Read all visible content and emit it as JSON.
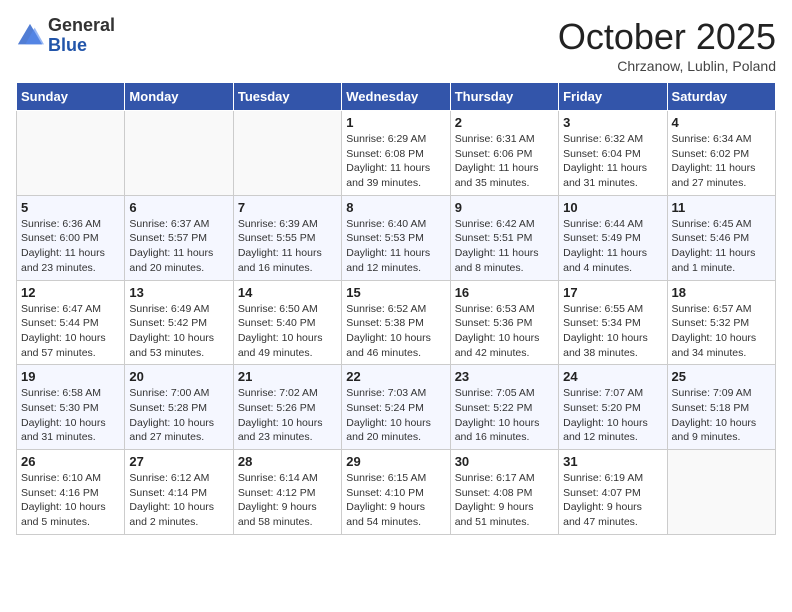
{
  "header": {
    "logo_general": "General",
    "logo_blue": "Blue",
    "month": "October 2025",
    "location": "Chrzanow, Lublin, Poland"
  },
  "weekdays": [
    "Sunday",
    "Monday",
    "Tuesday",
    "Wednesday",
    "Thursday",
    "Friday",
    "Saturday"
  ],
  "weeks": [
    [
      {
        "day": "",
        "info": ""
      },
      {
        "day": "",
        "info": ""
      },
      {
        "day": "",
        "info": ""
      },
      {
        "day": "1",
        "info": "Sunrise: 6:29 AM\nSunset: 6:08 PM\nDaylight: 11 hours\nand 39 minutes."
      },
      {
        "day": "2",
        "info": "Sunrise: 6:31 AM\nSunset: 6:06 PM\nDaylight: 11 hours\nand 35 minutes."
      },
      {
        "day": "3",
        "info": "Sunrise: 6:32 AM\nSunset: 6:04 PM\nDaylight: 11 hours\nand 31 minutes."
      },
      {
        "day": "4",
        "info": "Sunrise: 6:34 AM\nSunset: 6:02 PM\nDaylight: 11 hours\nand 27 minutes."
      }
    ],
    [
      {
        "day": "5",
        "info": "Sunrise: 6:36 AM\nSunset: 6:00 PM\nDaylight: 11 hours\nand 23 minutes."
      },
      {
        "day": "6",
        "info": "Sunrise: 6:37 AM\nSunset: 5:57 PM\nDaylight: 11 hours\nand 20 minutes."
      },
      {
        "day": "7",
        "info": "Sunrise: 6:39 AM\nSunset: 5:55 PM\nDaylight: 11 hours\nand 16 minutes."
      },
      {
        "day": "8",
        "info": "Sunrise: 6:40 AM\nSunset: 5:53 PM\nDaylight: 11 hours\nand 12 minutes."
      },
      {
        "day": "9",
        "info": "Sunrise: 6:42 AM\nSunset: 5:51 PM\nDaylight: 11 hours\nand 8 minutes."
      },
      {
        "day": "10",
        "info": "Sunrise: 6:44 AM\nSunset: 5:49 PM\nDaylight: 11 hours\nand 4 minutes."
      },
      {
        "day": "11",
        "info": "Sunrise: 6:45 AM\nSunset: 5:46 PM\nDaylight: 11 hours\nand 1 minute."
      }
    ],
    [
      {
        "day": "12",
        "info": "Sunrise: 6:47 AM\nSunset: 5:44 PM\nDaylight: 10 hours\nand 57 minutes."
      },
      {
        "day": "13",
        "info": "Sunrise: 6:49 AM\nSunset: 5:42 PM\nDaylight: 10 hours\nand 53 minutes."
      },
      {
        "day": "14",
        "info": "Sunrise: 6:50 AM\nSunset: 5:40 PM\nDaylight: 10 hours\nand 49 minutes."
      },
      {
        "day": "15",
        "info": "Sunrise: 6:52 AM\nSunset: 5:38 PM\nDaylight: 10 hours\nand 46 minutes."
      },
      {
        "day": "16",
        "info": "Sunrise: 6:53 AM\nSunset: 5:36 PM\nDaylight: 10 hours\nand 42 minutes."
      },
      {
        "day": "17",
        "info": "Sunrise: 6:55 AM\nSunset: 5:34 PM\nDaylight: 10 hours\nand 38 minutes."
      },
      {
        "day": "18",
        "info": "Sunrise: 6:57 AM\nSunset: 5:32 PM\nDaylight: 10 hours\nand 34 minutes."
      }
    ],
    [
      {
        "day": "19",
        "info": "Sunrise: 6:58 AM\nSunset: 5:30 PM\nDaylight: 10 hours\nand 31 minutes."
      },
      {
        "day": "20",
        "info": "Sunrise: 7:00 AM\nSunset: 5:28 PM\nDaylight: 10 hours\nand 27 minutes."
      },
      {
        "day": "21",
        "info": "Sunrise: 7:02 AM\nSunset: 5:26 PM\nDaylight: 10 hours\nand 23 minutes."
      },
      {
        "day": "22",
        "info": "Sunrise: 7:03 AM\nSunset: 5:24 PM\nDaylight: 10 hours\nand 20 minutes."
      },
      {
        "day": "23",
        "info": "Sunrise: 7:05 AM\nSunset: 5:22 PM\nDaylight: 10 hours\nand 16 minutes."
      },
      {
        "day": "24",
        "info": "Sunrise: 7:07 AM\nSunset: 5:20 PM\nDaylight: 10 hours\nand 12 minutes."
      },
      {
        "day": "25",
        "info": "Sunrise: 7:09 AM\nSunset: 5:18 PM\nDaylight: 10 hours\nand 9 minutes."
      }
    ],
    [
      {
        "day": "26",
        "info": "Sunrise: 6:10 AM\nSunset: 4:16 PM\nDaylight: 10 hours\nand 5 minutes."
      },
      {
        "day": "27",
        "info": "Sunrise: 6:12 AM\nSunset: 4:14 PM\nDaylight: 10 hours\nand 2 minutes."
      },
      {
        "day": "28",
        "info": "Sunrise: 6:14 AM\nSunset: 4:12 PM\nDaylight: 9 hours\nand 58 minutes."
      },
      {
        "day": "29",
        "info": "Sunrise: 6:15 AM\nSunset: 4:10 PM\nDaylight: 9 hours\nand 54 minutes."
      },
      {
        "day": "30",
        "info": "Sunrise: 6:17 AM\nSunset: 4:08 PM\nDaylight: 9 hours\nand 51 minutes."
      },
      {
        "day": "31",
        "info": "Sunrise: 6:19 AM\nSunset: 4:07 PM\nDaylight: 9 hours\nand 47 minutes."
      },
      {
        "day": "",
        "info": ""
      }
    ]
  ]
}
